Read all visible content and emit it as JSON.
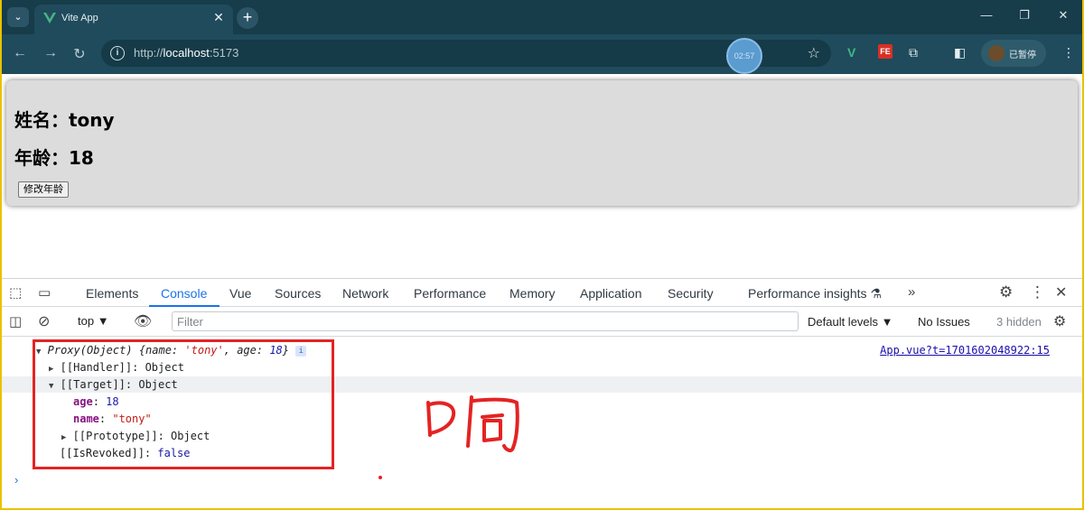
{
  "browser": {
    "tab_title": "Vite App",
    "url_prefix": "http://",
    "url_host": "localhost",
    "url_port": ":5173",
    "rec_time": "02:57",
    "profile_label": "已暂停",
    "accent": "#1f4b5c"
  },
  "page": {
    "name_line": "姓名：tony",
    "age_line": "年龄：18",
    "modify_button": "修改年龄"
  },
  "devtools": {
    "tabs": [
      "Elements",
      "Console",
      "Vue",
      "Sources",
      "Network",
      "Performance",
      "Memory",
      "Application",
      "Security",
      "Performance insights"
    ],
    "active_tab": "Console",
    "context": "top",
    "filter_placeholder": "Filter",
    "levels": "Default levels",
    "issues": "No Issues",
    "hidden": "3 hidden",
    "source_link": "App.vue?t=1701602048922:15",
    "log": {
      "head_prefix": "Proxy(Object) ",
      "head_obj_open": "{name: ",
      "head_name": "'tony'",
      "head_mid": ", age: ",
      "head_age": "18",
      "head_close": "}",
      "handler": "[[Handler]]: Object",
      "target": "[[Target]]: Object",
      "age_key": "age",
      "age_val": "18",
      "name_key": "name",
      "name_val": "\"tony\"",
      "prototype": "[[Prototype]]: Object",
      "revoked_key": "[[IsRevoked]]: ",
      "revoked_val": "false"
    }
  },
  "annotation": {
    "handwritten_text": "响"
  }
}
